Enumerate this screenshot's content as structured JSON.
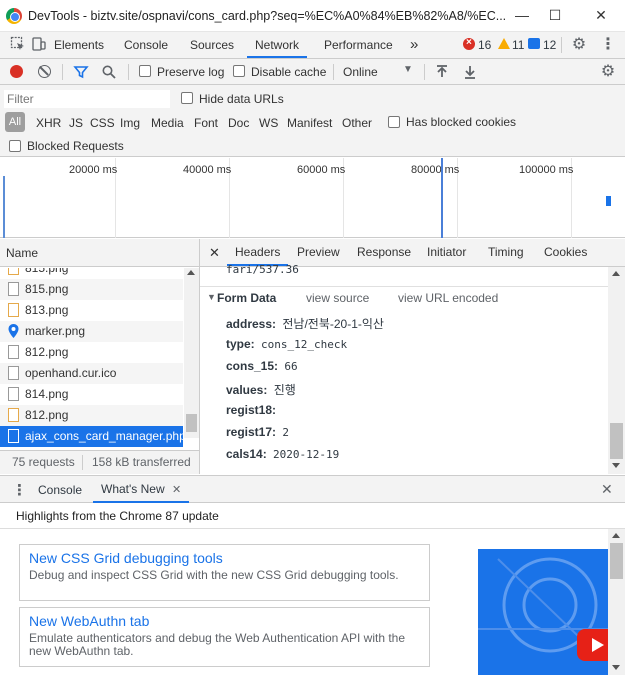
{
  "window": {
    "title": "DevTools - biztv.site/ospnavi/cons_card.php?seq=%EC%A0%84%EB%82%A8/%EC...",
    "minimize": "—",
    "maximize": "☐",
    "close": "✕"
  },
  "main_tabs": {
    "items": [
      "Elements",
      "Console",
      "Sources",
      "Network",
      "Performance"
    ],
    "more": "»",
    "active": "Network",
    "errors": "16",
    "warnings": "11",
    "messages": "12"
  },
  "toolbar": {
    "preserve_log": "Preserve log",
    "disable_cache": "Disable cache",
    "throttling": "Online"
  },
  "filter": {
    "placeholder": "Filter",
    "hide_data_urls": "Hide data URLs",
    "types": [
      "All",
      "XHR",
      "JS",
      "CSS",
      "Img",
      "Media",
      "Font",
      "Doc",
      "WS",
      "Manifest",
      "Other"
    ],
    "has_blocked_cookies": "Has blocked cookies",
    "blocked_requests": "Blocked Requests"
  },
  "overview": {
    "ticks": [
      "20000 ms",
      "40000 ms",
      "60000 ms",
      "80000 ms",
      "100000 ms"
    ]
  },
  "requests": {
    "header": "Name",
    "items": [
      "815.png",
      "815.png",
      "813.png",
      "marker.png",
      "812.png",
      "openhand.cur.ico",
      "814.png",
      "812.png",
      "ajax_cons_card_manager.php"
    ],
    "status_count": "75 requests",
    "status_transferred": "158 kB transferred"
  },
  "detail": {
    "close": "✕",
    "tabs": [
      "Headers",
      "Preview",
      "Response",
      "Initiator",
      "Timing",
      "Cookies"
    ],
    "active_tab": "Headers",
    "partial_line": "fari/537.36",
    "section_title": "Form Data",
    "view_source": "view source",
    "view_url_encoded": "view URL encoded",
    "form_data": [
      {
        "key": "address:",
        "value": "전남/전북-20-1-익산"
      },
      {
        "key": "type:",
        "value": "cons_12_check"
      },
      {
        "key": "cons_15:",
        "value": "66"
      },
      {
        "key": "values:",
        "value": "진행"
      },
      {
        "key": "regist18:",
        "value": ""
      },
      {
        "key": "regist17:",
        "value": "2"
      },
      {
        "key": "cals14:",
        "value": "2020-12-19"
      }
    ]
  },
  "drawer": {
    "menu": "⋮",
    "tabs": [
      "Console",
      "What's New"
    ],
    "active_tab": "What's New",
    "tab_close": "✕",
    "close": "✕",
    "highlights": "Highlights from the Chrome 87 update",
    "cards": [
      {
        "title": "New CSS Grid debugging tools",
        "desc": "Debug and inspect CSS Grid with the new CSS Grid debugging tools."
      },
      {
        "title": "New WebAuthn tab",
        "desc": "Emulate authenticators and debug the Web Authentication API with the new WebAuthn tab."
      }
    ]
  },
  "colors": {
    "accent": "#1a73e8",
    "record": "#d93025",
    "error": "#d93025",
    "warning": "#f9ab00",
    "info": "#1a73e8"
  }
}
